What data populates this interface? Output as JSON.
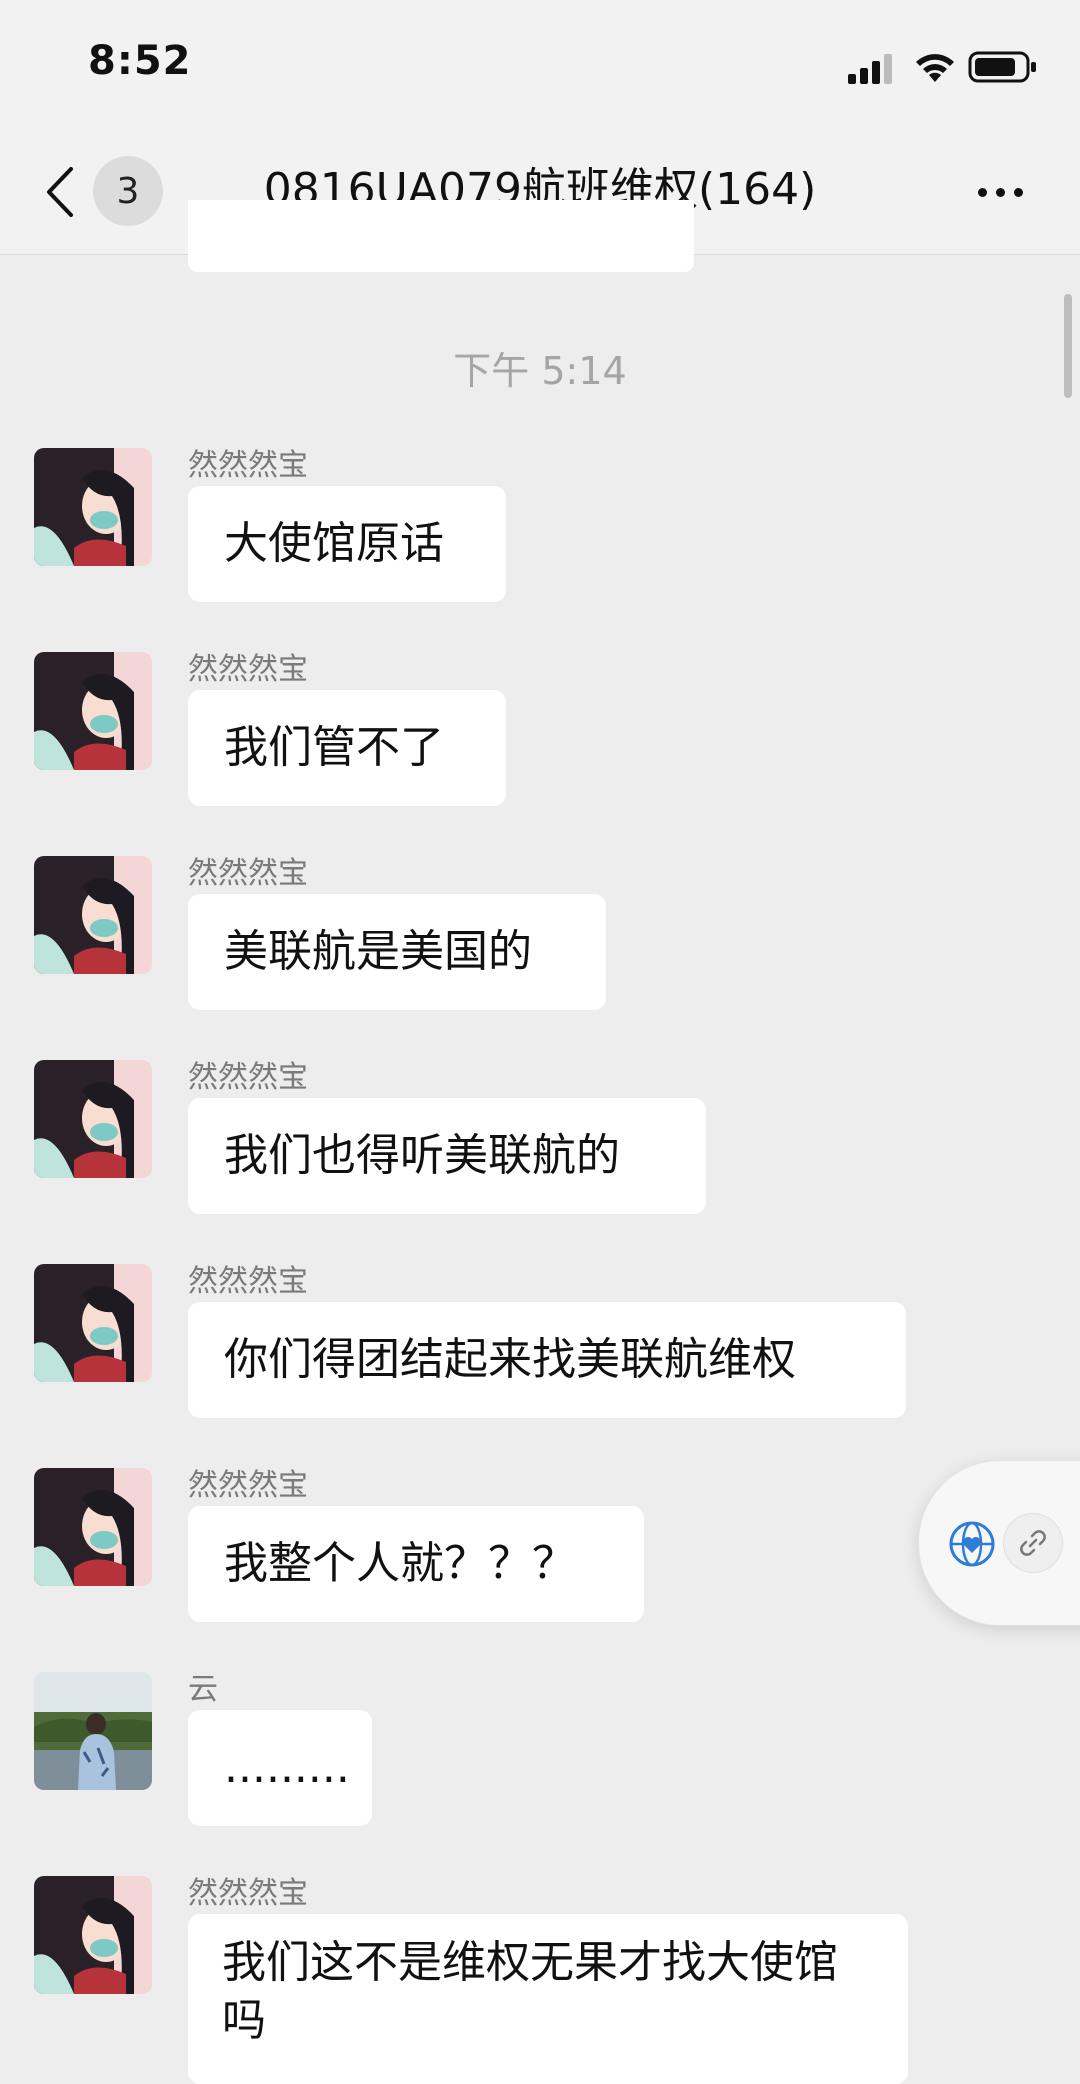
{
  "status_bar": {
    "time": "8:52"
  },
  "header": {
    "unread_count": "3",
    "title": "0816UA079航班维权(164)"
  },
  "timestamp": "下午 5:14",
  "messages": [
    {
      "sender": "然然然宝",
      "text": "大使馆原话"
    },
    {
      "sender": "然然然宝",
      "text": "我们管不了"
    },
    {
      "sender": "然然然宝",
      "text": "美联航是美国的"
    },
    {
      "sender": "然然然宝",
      "text": "我们也得听美联航的"
    },
    {
      "sender": "然然然宝",
      "text": "你们得团结起来找美联航维权"
    },
    {
      "sender": "然然然宝",
      "text": "我整个人就？？？"
    },
    {
      "sender": "云",
      "text": "........."
    },
    {
      "sender": "然然然宝",
      "text": "我们这不是维权无果才找大使馆吗"
    }
  ],
  "icons": {
    "back": "chevron-left-icon",
    "more": "more-dots-icon",
    "float_globe": "globe-heart-icon",
    "float_link": "link-icon"
  },
  "colors": {
    "background": "#ededed",
    "bubble": "#ffffff",
    "header": "#f2f2f2",
    "timestamp": "#a5a5a5",
    "sender": "#7a7a7a",
    "globe_accent": "#2f7dd6"
  }
}
